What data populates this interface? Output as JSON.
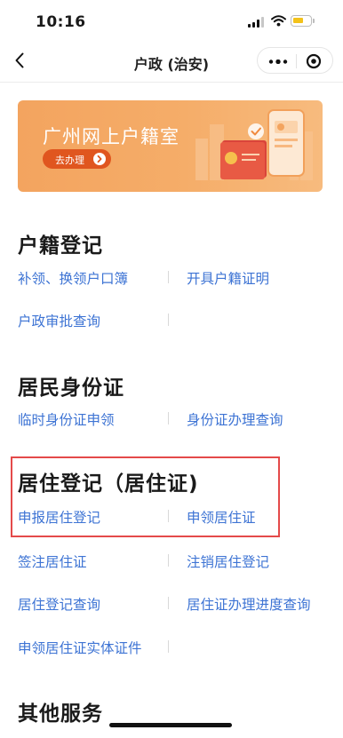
{
  "status_bar": {
    "time": "10:16"
  },
  "navbar": {
    "title": "户政 (治安)",
    "more_icon": "more-dots-icon",
    "close_icon": "mini-program-close-icon"
  },
  "banner": {
    "title": "广州网上户籍室",
    "button_label": "去办理"
  },
  "sections": [
    {
      "title": "户籍登记",
      "links": [
        "补领、换领户口簿",
        "开具户籍证明",
        "户政审批查询"
      ]
    },
    {
      "title": "居民身份证",
      "links": [
        "临时身份证申领",
        "身份证办理查询"
      ]
    },
    {
      "title": "居住登记（居住证)",
      "links": [
        "申报居住登记",
        "申领居住证",
        "签注居住证",
        "注销居住登记",
        "居住登记查询",
        "居住证办理进度查询",
        "申领居住证实体证件"
      ]
    },
    {
      "title": "其他服务",
      "links": []
    }
  ],
  "colors": {
    "link": "#3e74d4",
    "banner": "#f5ad69",
    "banner_button": "#e0561f",
    "highlight": "#e44a4a"
  }
}
